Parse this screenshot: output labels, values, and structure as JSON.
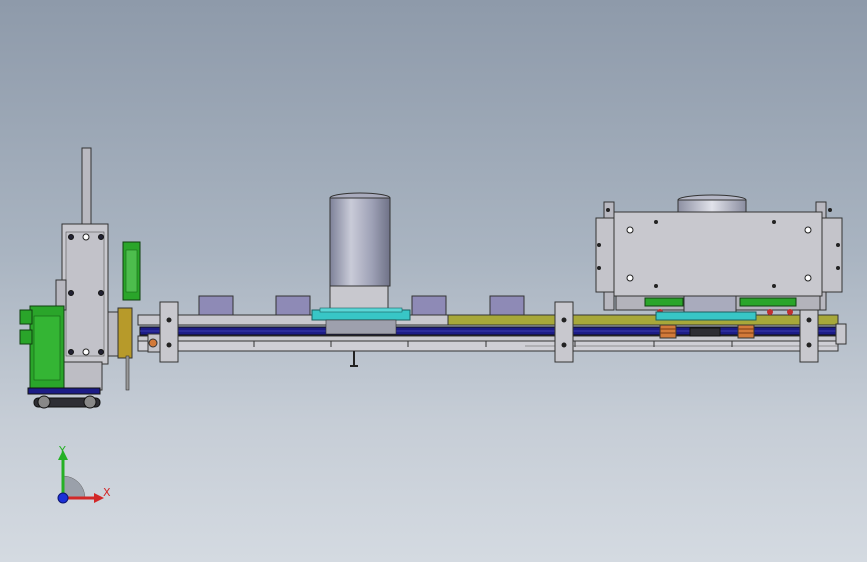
{
  "triad": {
    "y_label": "Y",
    "x_label": "X",
    "colors": {
      "x": "#d22828",
      "y": "#25b025",
      "z": "#1b2fd8"
    }
  },
  "colors": {
    "frame_gray": "#c8c8ce",
    "olive_rail": "#a7a83a",
    "blue_belt": "#1c1c86",
    "green_motor": "#2aa52a",
    "cyan_plate": "#38c6c6",
    "block_purple": "#8e8ab6",
    "orange_spring": "#d27a3a"
  }
}
